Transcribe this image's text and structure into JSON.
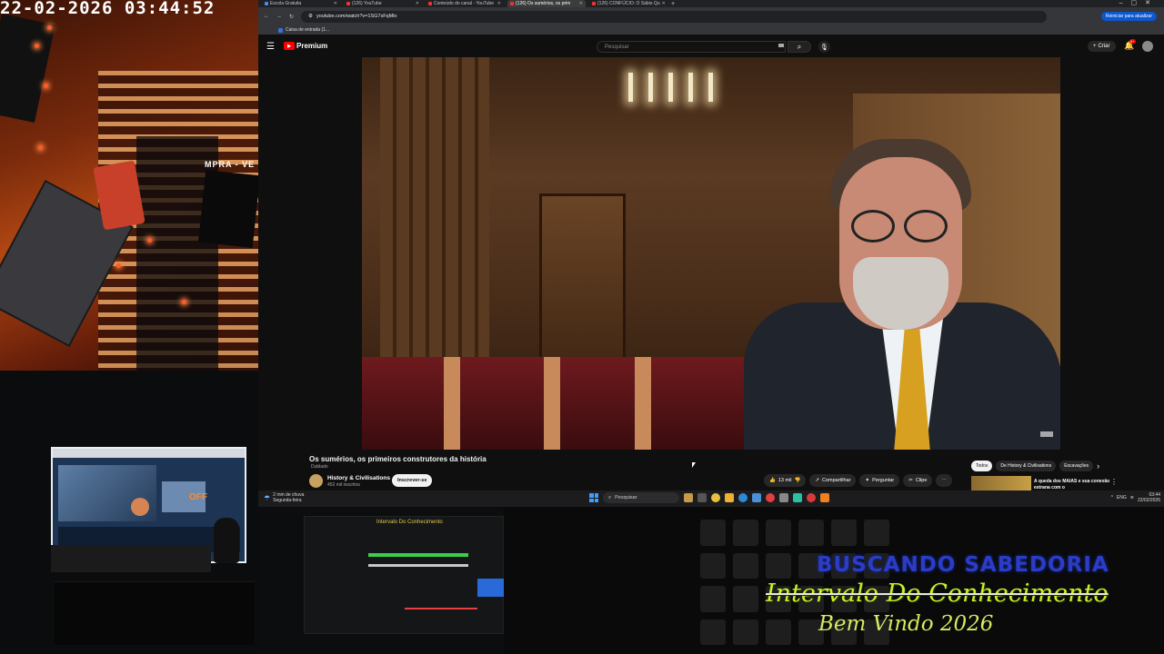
{
  "webcam": {
    "timestamp": "22-02-2026  03:44:52",
    "sign_text": "MPRA - VE"
  },
  "browser": {
    "tabs": [
      {
        "label": "Escola Gratuita"
      },
      {
        "label": "(126) YouTube"
      },
      {
        "label": "Conteúdo do canal - YouTube"
      },
      {
        "label": "(126) Os sumérios, os prim"
      },
      {
        "label": "(126) CONFÚCIO: O Sábio Qu"
      }
    ],
    "url": "youtube.com/watch?v=1SG7sFqMlo",
    "restart_label": "Reiniciar para atualizar",
    "bookmark": "Caixa de entrada (1..."
  },
  "youtube": {
    "logo": "Premium",
    "search_placeholder": "Pesquisar",
    "create_label": "Criar",
    "notif_count": "9+",
    "video_title": "Os sumérios, os primeiros construtores da história",
    "video_sub": "Dublado",
    "channel_name": "History & Civilisations",
    "channel_subs": "452 mil inscritos",
    "subscribe_label": "Inscrever-se",
    "likes": "13 mil",
    "share_label": "Compartilhar",
    "ask_label": "Perguntar",
    "clip_label": "Clipe",
    "chips": [
      "Todos",
      "De History & Civilisations",
      "Escavações"
    ],
    "rec_title": "A queda dos MAIAS e sua conexão estrana com o"
  },
  "taskbar": {
    "weather_temp": "2 mm de chuva",
    "weather_day": "Segunda-feira",
    "search_label": "Pesquisar",
    "lang": "ENG",
    "time": "03:44",
    "date": "22/02/2026"
  },
  "bottom": {
    "mini_title": "Intervalo Do Conhecimento"
  },
  "overlay": {
    "line1": "BUSCANDO SABEDORIA",
    "line2": "Intervalo Do Conhecimento",
    "line3": "Bem Vindo 2026"
  },
  "colors": {
    "yt_red": "#ff0000",
    "overlay_green": "#c8f02a",
    "overlay_blue": "#2a3cc8"
  }
}
